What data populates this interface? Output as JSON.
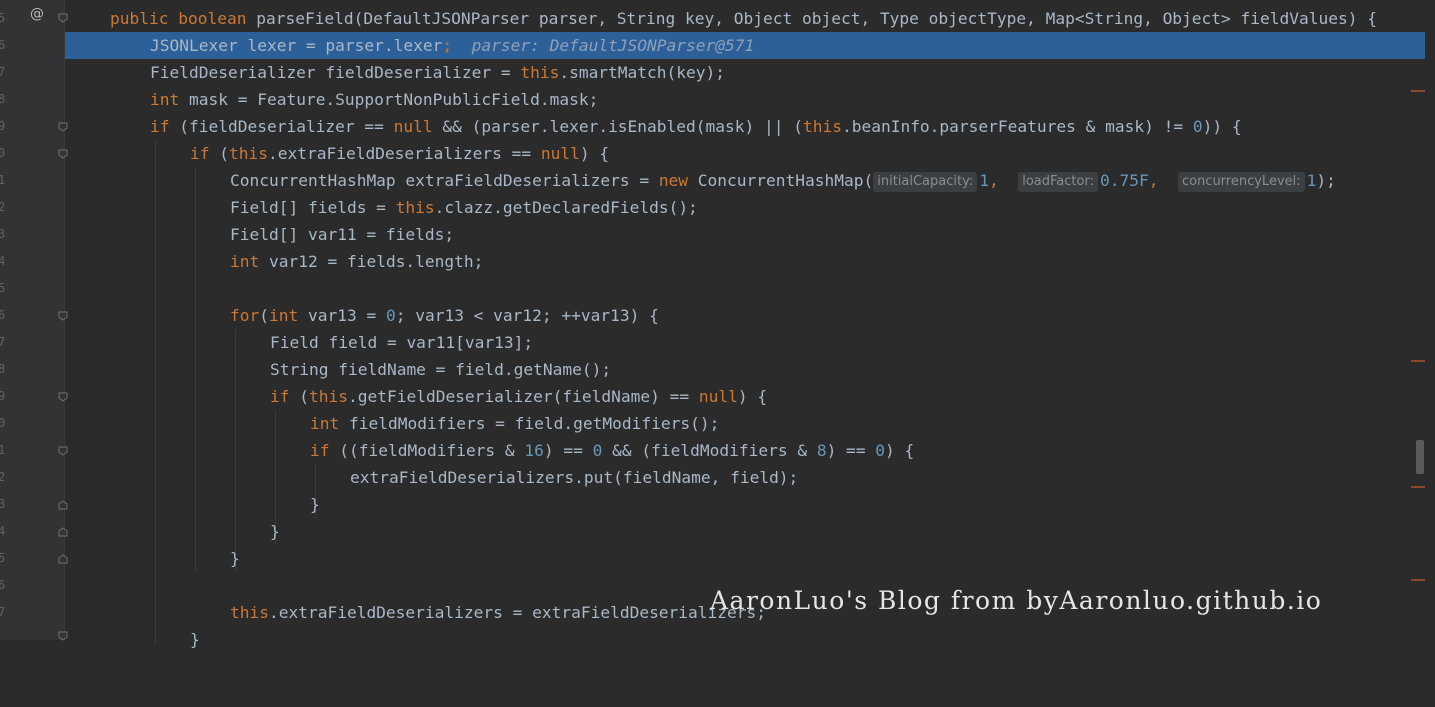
{
  "gutter": {
    "annotation_symbol": "@",
    "line_numbers": [
      "4",
      "5",
      "6",
      "7",
      "8",
      "9",
      "0",
      "1",
      "2",
      "3",
      "4",
      "5",
      "6",
      "7",
      "8",
      "9",
      "0",
      "1",
      "2",
      "3",
      "4",
      "5",
      "6",
      "7"
    ]
  },
  "code": {
    "l1_tokens": {
      "kw1": "public",
      "kw2": "boolean",
      "rest": " parseField(DefaultJSONParser parser, String key, Object object, Type objectType, Map<String, Object> fieldValues) {"
    },
    "l2": {
      "code": "JSONLexer lexer = parser.lexer",
      "semi": ";",
      "debug": "parser: DefaultJSONParser@571"
    },
    "l3": {
      "a": "FieldDeserializer fieldDeserializer = ",
      "this": "this",
      "b": ".smartMatch(key);"
    },
    "l4": {
      "kw": "int",
      "rest": " mask = Feature.SupportNonPublicField.mask;"
    },
    "l5": {
      "kw_if": "if",
      "a": " (fieldDeserializer == ",
      "null": "null",
      "b": " && (parser.lexer.isEnabled(mask) || (",
      "this": "this",
      "c": ".beanInfo.parserFeatures & mask) != ",
      "zero": "0",
      "d": ")) {"
    },
    "l6": {
      "kw_if": "if",
      "a": " (",
      "this": "this",
      "b": ".extraFieldDeserializers == ",
      "null": "null",
      "c": ") {"
    },
    "l7": {
      "a": "ConcurrentHashMap extraFieldDeserializers = ",
      "new": "new",
      "b": " ConcurrentHashMap(",
      "hint1": "initialCapacity:",
      "v1": "1",
      "c1": ",",
      "hint2": "loadFactor:",
      "v2": "0.75F",
      "c2": ",",
      "hint3": "concurrencyLevel:",
      "v3": "1",
      "end": ");"
    },
    "l8": {
      "a": "Field[] fields = ",
      "this": "this",
      "b": ".clazz.getDeclaredFields();"
    },
    "l9": {
      "a": "Field[] var11 = fields;"
    },
    "l10": {
      "kw": "int",
      "rest": " var12 = fields.length;"
    },
    "l12": {
      "kw_for": "for",
      "a": "(",
      "kw_int": "int",
      "b": " var13 = ",
      "zero": "0",
      "c": "; var13 < var12; ++var13) {"
    },
    "l13": {
      "a": "Field field = var11[var13];"
    },
    "l14": {
      "a": "String fieldName = field.getName();"
    },
    "l15": {
      "kw_if": "if",
      "a": " (",
      "this": "this",
      "b": ".getFieldDeserializer(fieldName) == ",
      "null": "null",
      "c": ") {"
    },
    "l16": {
      "kw": "int",
      "rest": " fieldModifiers = field.getModifiers();"
    },
    "l17": {
      "kw_if": "if",
      "a": " ((fieldModifiers & ",
      "n16": "16",
      "b": ") == ",
      "z1": "0",
      "c": " && (fieldModifiers & ",
      "n8": "8",
      "d": ") == ",
      "z2": "0",
      "e": ") {"
    },
    "l18": {
      "a": "extraFieldDeserializers.put(fieldName, field);"
    },
    "brace": "}",
    "l23": {
      "this": "this",
      "a": ".extraFieldDeserializers = extraFieldDeserializers;"
    }
  },
  "watermark": "AaronLuo's Blog from byAaronluo.github.io",
  "colors": {
    "background": "#2b2b2b",
    "keyword": "#cc7832",
    "number": "#6897bb",
    "text": "#a9b7c6",
    "current_line": "#2d6099"
  }
}
